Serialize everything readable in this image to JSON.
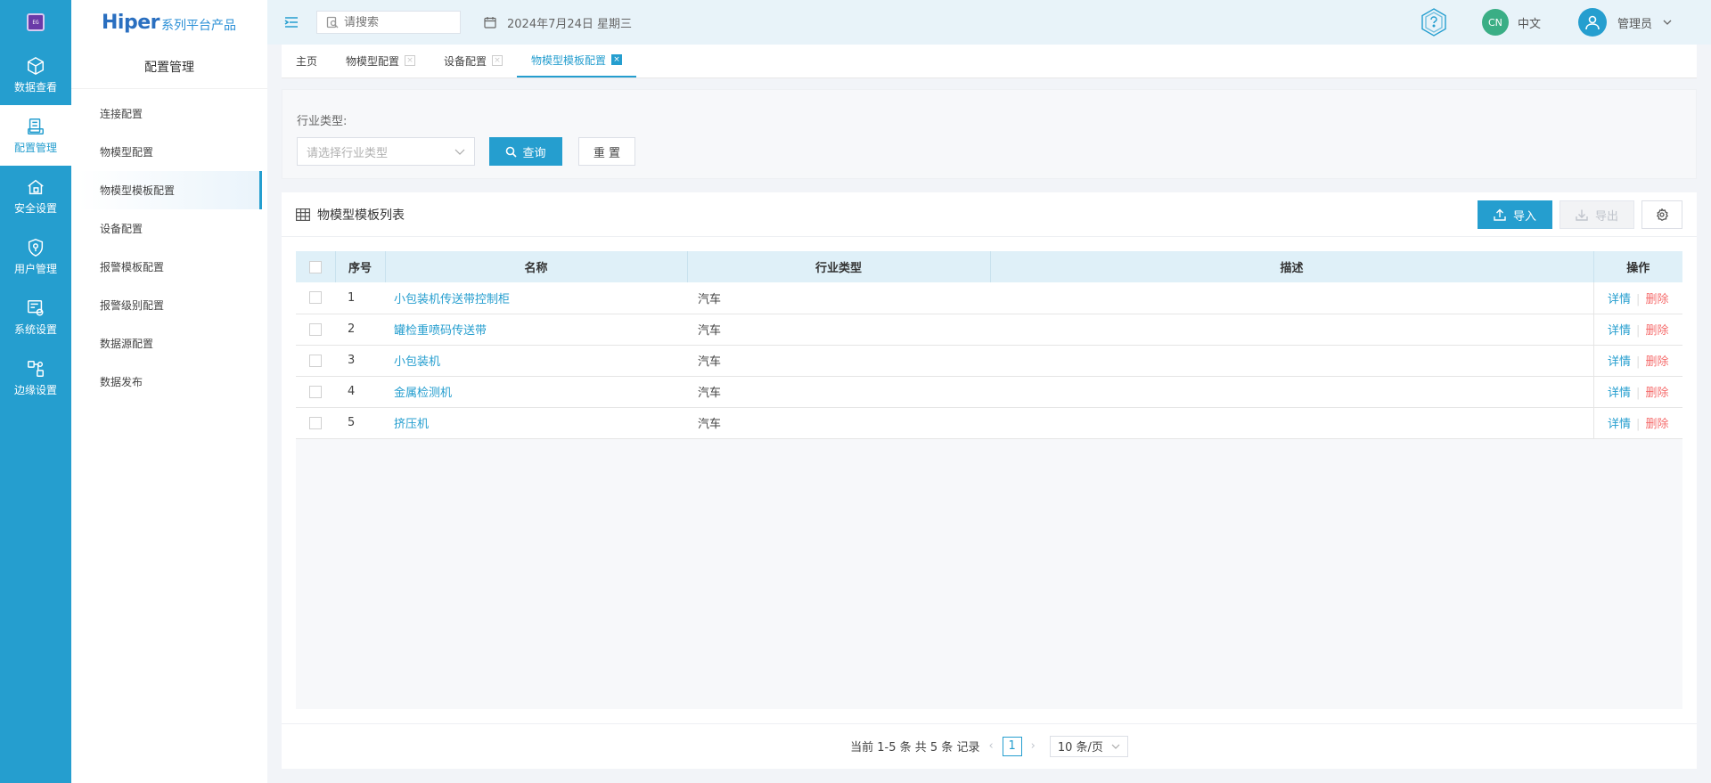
{
  "rail": {
    "logo_text": "EG",
    "items": [
      {
        "label": "数据查看",
        "icon": "cube-icon",
        "active": false
      },
      {
        "label": "配置管理",
        "icon": "config-icon",
        "active": true
      },
      {
        "label": "安全设置",
        "icon": "security-icon",
        "active": false
      },
      {
        "label": "用户管理",
        "icon": "user-shield-icon",
        "active": false
      },
      {
        "label": "系统设置",
        "icon": "system-settings-icon",
        "active": false
      },
      {
        "label": "边缘设置",
        "icon": "edge-settings-icon",
        "active": false
      }
    ]
  },
  "brand": {
    "name": "Hiper",
    "suffix": "系列平台产品"
  },
  "sidebar": {
    "title": "配置管理",
    "items": [
      {
        "label": "连接配置"
      },
      {
        "label": "物模型配置"
      },
      {
        "label": "物模型模板配置"
      },
      {
        "label": "设备配置"
      },
      {
        "label": "报警模板配置"
      },
      {
        "label": "报警级别配置"
      },
      {
        "label": "数据源配置"
      },
      {
        "label": "数据发布"
      }
    ],
    "active_index": 2
  },
  "header": {
    "search_placeholder": "请搜索",
    "date": "2024年7月24日 星期三",
    "lang_badge": "CN",
    "lang_label": "中文",
    "user": "管理员"
  },
  "tabs": [
    {
      "label": "主页",
      "closable": false,
      "active": false
    },
    {
      "label": "物模型配置",
      "closable": true,
      "active": false
    },
    {
      "label": "设备配置",
      "closable": true,
      "active": false
    },
    {
      "label": "物模型模板配置",
      "closable": true,
      "active": true
    }
  ],
  "filter": {
    "industry_label": "行业类型:",
    "industry_placeholder": "请选择行业类型",
    "query_label": "查询",
    "reset_label": "重 置"
  },
  "list": {
    "title": "物模型模板列表",
    "import_label": "导入",
    "export_label": "导出",
    "columns": [
      "序号",
      "名称",
      "行业类型",
      "描述",
      "操作"
    ],
    "rows": [
      {
        "index": "1",
        "name": "小包装机传送带控制柜",
        "industry": "汽车",
        "desc": ""
      },
      {
        "index": "2",
        "name": "罐检重喷码传送带",
        "industry": "汽车",
        "desc": ""
      },
      {
        "index": "3",
        "name": "小包装机",
        "industry": "汽车",
        "desc": ""
      },
      {
        "index": "4",
        "name": "金属检测机",
        "industry": "汽车",
        "desc": ""
      },
      {
        "index": "5",
        "name": "挤压机",
        "industry": "汽车",
        "desc": ""
      }
    ],
    "op_detail": "详情",
    "op_delete": "删除"
  },
  "pagination": {
    "summary": "当前 1-5 条 共 5 条 记录",
    "current_page": "1",
    "page_size": "10 条/页"
  },
  "colors": {
    "primary": "#259ecf",
    "danger": "#f56c6c",
    "badge": "#3aae85"
  }
}
